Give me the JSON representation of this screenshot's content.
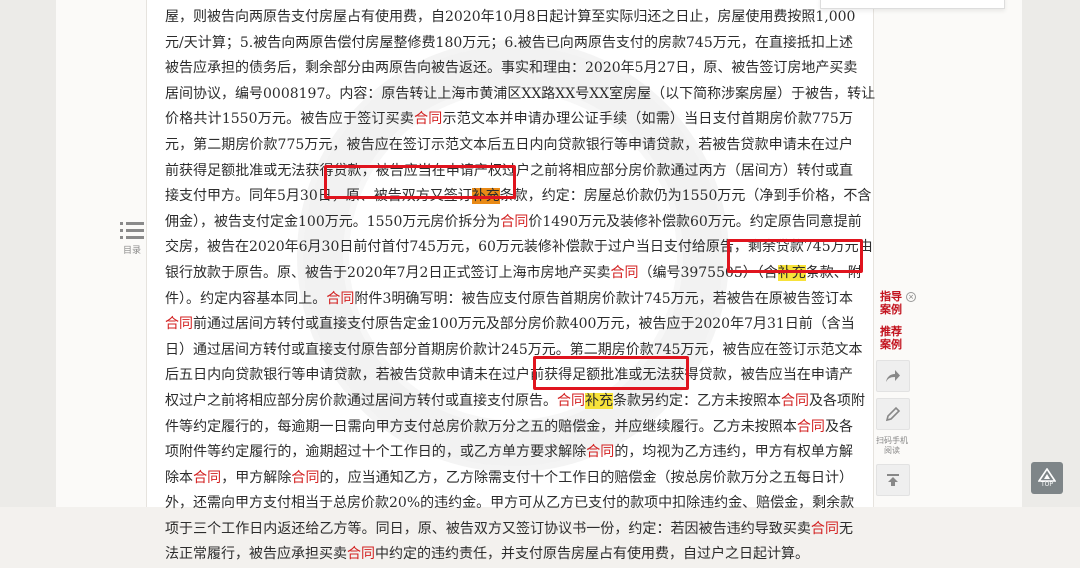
{
  "document": {
    "lines": [
      [
        {
          "t": "屋，则被告向两原告支付房屋占有使用费，自2020年10月8日起计算至实际归还之日止，房屋使用费按照1,000"
        }
      ],
      [
        {
          "t": "元/天计算；5.被告向两原告偿付房屋整修费180万元；6.被告已向两原告支付的房款745万元，在直接抵扣上述"
        }
      ],
      [
        {
          "t": "被告应承担的债务后，剩余部分由两原告向被告返还。事实和理由：2020年5月27日，原、被告签订房地产买卖"
        }
      ],
      [
        {
          "t": "居间协议，编号0008197。内容：原告转让上海市黄浦区XX路XX号XX室房屋（以下简称涉案房屋）于被告，转让"
        }
      ],
      [
        {
          "t": "价格共计1550万元。被告应于签订买卖"
        },
        {
          "t": "合同",
          "k": "kw"
        },
        {
          "t": "示范文本并申请办理公证手续（如需）当日支付首期房价款775万"
        }
      ],
      [
        {
          "t": "元，第二期房价款775万元，被告应在签订示范文本后五日内向贷款银行等申请贷款，若被告贷款申请未在过户"
        }
      ],
      [
        {
          "t": "前获得足额批准或无法获得贷款，被告应当在申请产权过户之前将相应部分房价款通过丙方（居间方）转付或直"
        }
      ],
      [
        {
          "t": "接支付甲方。同年5月30日，原、被告双方又签订"
        },
        {
          "t": "补充",
          "k": "hl2"
        },
        {
          "t": "条款，约定：房屋总价款仍为1550万元（净到手价格，不含"
        }
      ],
      [
        {
          "t": "佣金），被告支付定金100万元。1550万元房价拆分为"
        },
        {
          "t": "合同",
          "k": "kw"
        },
        {
          "t": "价1490万元及装修补偿款60万元。约定原告同意提前"
        }
      ],
      [
        {
          "t": "交房，被告在2020年6月30日前付首付745万元，60万元装修补偿款于过户当日支付给原告，剩余贷款745万元由"
        }
      ],
      [
        {
          "t": "银行放款于原告。原、被告于2020年7月2日正式签订上海市房地产买卖"
        },
        {
          "t": "合同",
          "k": "kw"
        },
        {
          "t": "（编号3975505）（含"
        },
        {
          "t": "补充",
          "k": "hl"
        },
        {
          "t": "条款、附"
        }
      ],
      [
        {
          "t": "件）。约定内容基本同上。"
        },
        {
          "t": "合同",
          "k": "kw"
        },
        {
          "t": "附件3明确写明：被告应支付原告首期房价款计745万元，若被告在原被告签订本"
        }
      ],
      [
        {
          "t": "合同",
          "k": "kw"
        },
        {
          "t": "前通过居间方转付或直接支付原告定金100万元及部分房价款400万元，被告应于2020年7月31日前（含当"
        }
      ],
      [
        {
          "t": "日）通过居间方转付或直接支付原告部分首期房价款计245万元。第二期房价款745万元，被告应在签订示范文本"
        }
      ],
      [
        {
          "t": "后五日内向贷款银行等申请贷款，若被告贷款申请未在过户前获得足额批准或无法获得贷款，被告应当在申请产"
        }
      ],
      [
        {
          "t": "权过户之前将相应部分房价款通过居间方转付或直接支付原告。"
        },
        {
          "t": "合同",
          "k": "kw"
        },
        {
          "t": "补充",
          "k": "hl"
        },
        {
          "t": "条款另约定：乙方未按照本"
        },
        {
          "t": "合同",
          "k": "kw"
        },
        {
          "t": "及各项附"
        }
      ],
      [
        {
          "t": "件等约定履行的，每逾期一日需向甲方支付总房价款万分之五的赔偿金，并应继续履行。乙方未按照本"
        },
        {
          "t": "合同",
          "k": "kw"
        },
        {
          "t": "及各"
        }
      ],
      [
        {
          "t": "项附件等约定履行的，逾期超过十个工作日的，或乙方单方要求解除"
        },
        {
          "t": "合同",
          "k": "kw"
        },
        {
          "t": "的，均视为乙方违约，甲方有权单方解"
        }
      ],
      [
        {
          "t": "除本"
        },
        {
          "t": "合同",
          "k": "kw"
        },
        {
          "t": "，甲方解除"
        },
        {
          "t": "合同",
          "k": "kw"
        },
        {
          "t": "的，应当通知乙方，乙方除需支付十个工作日的赔偿金（按总房价款万分之五每日计）"
        }
      ],
      [
        {
          "t": "外，还需向甲方支付相当于总房价款20%的违约金。甲方可从乙方已支付的款项中扣除违约金、赔偿金，剩余款"
        }
      ],
      [
        {
          "t": "项于三个工作日内返还给乙方等。同日，原、被告双方又签订协议书一份，约定：若因被告违约导致买卖"
        },
        {
          "t": "合同",
          "k": "kw"
        },
        {
          "t": "无"
        }
      ],
      [
        {
          "t": "法正常履行，被告应承担买卖"
        },
        {
          "t": "合同",
          "k": "kw"
        },
        {
          "t": "中约定的违约责任，并支付原告房屋占有使用费，自过户之日起计算。"
        }
      ]
    ]
  },
  "toc": {
    "label": "目录",
    "icon": "list-icon"
  },
  "sidebar": {
    "guide_case": "指导案例",
    "recommend_case": "推荐案例",
    "share_icon": "share-icon",
    "edit_icon": "pencil-icon",
    "scan_label": "扫码手机阅读",
    "top_icon": "arrow-up-bar-icon",
    "close_icon": "close-icon"
  },
  "back_to_top": {
    "label": "TOP",
    "icon": "triangle-up-icon"
  },
  "colors": {
    "keyword": "#d32222",
    "highlight": "#f7e23a",
    "highlight_active": "#e98a16",
    "annotation_box": "#e0141e"
  }
}
